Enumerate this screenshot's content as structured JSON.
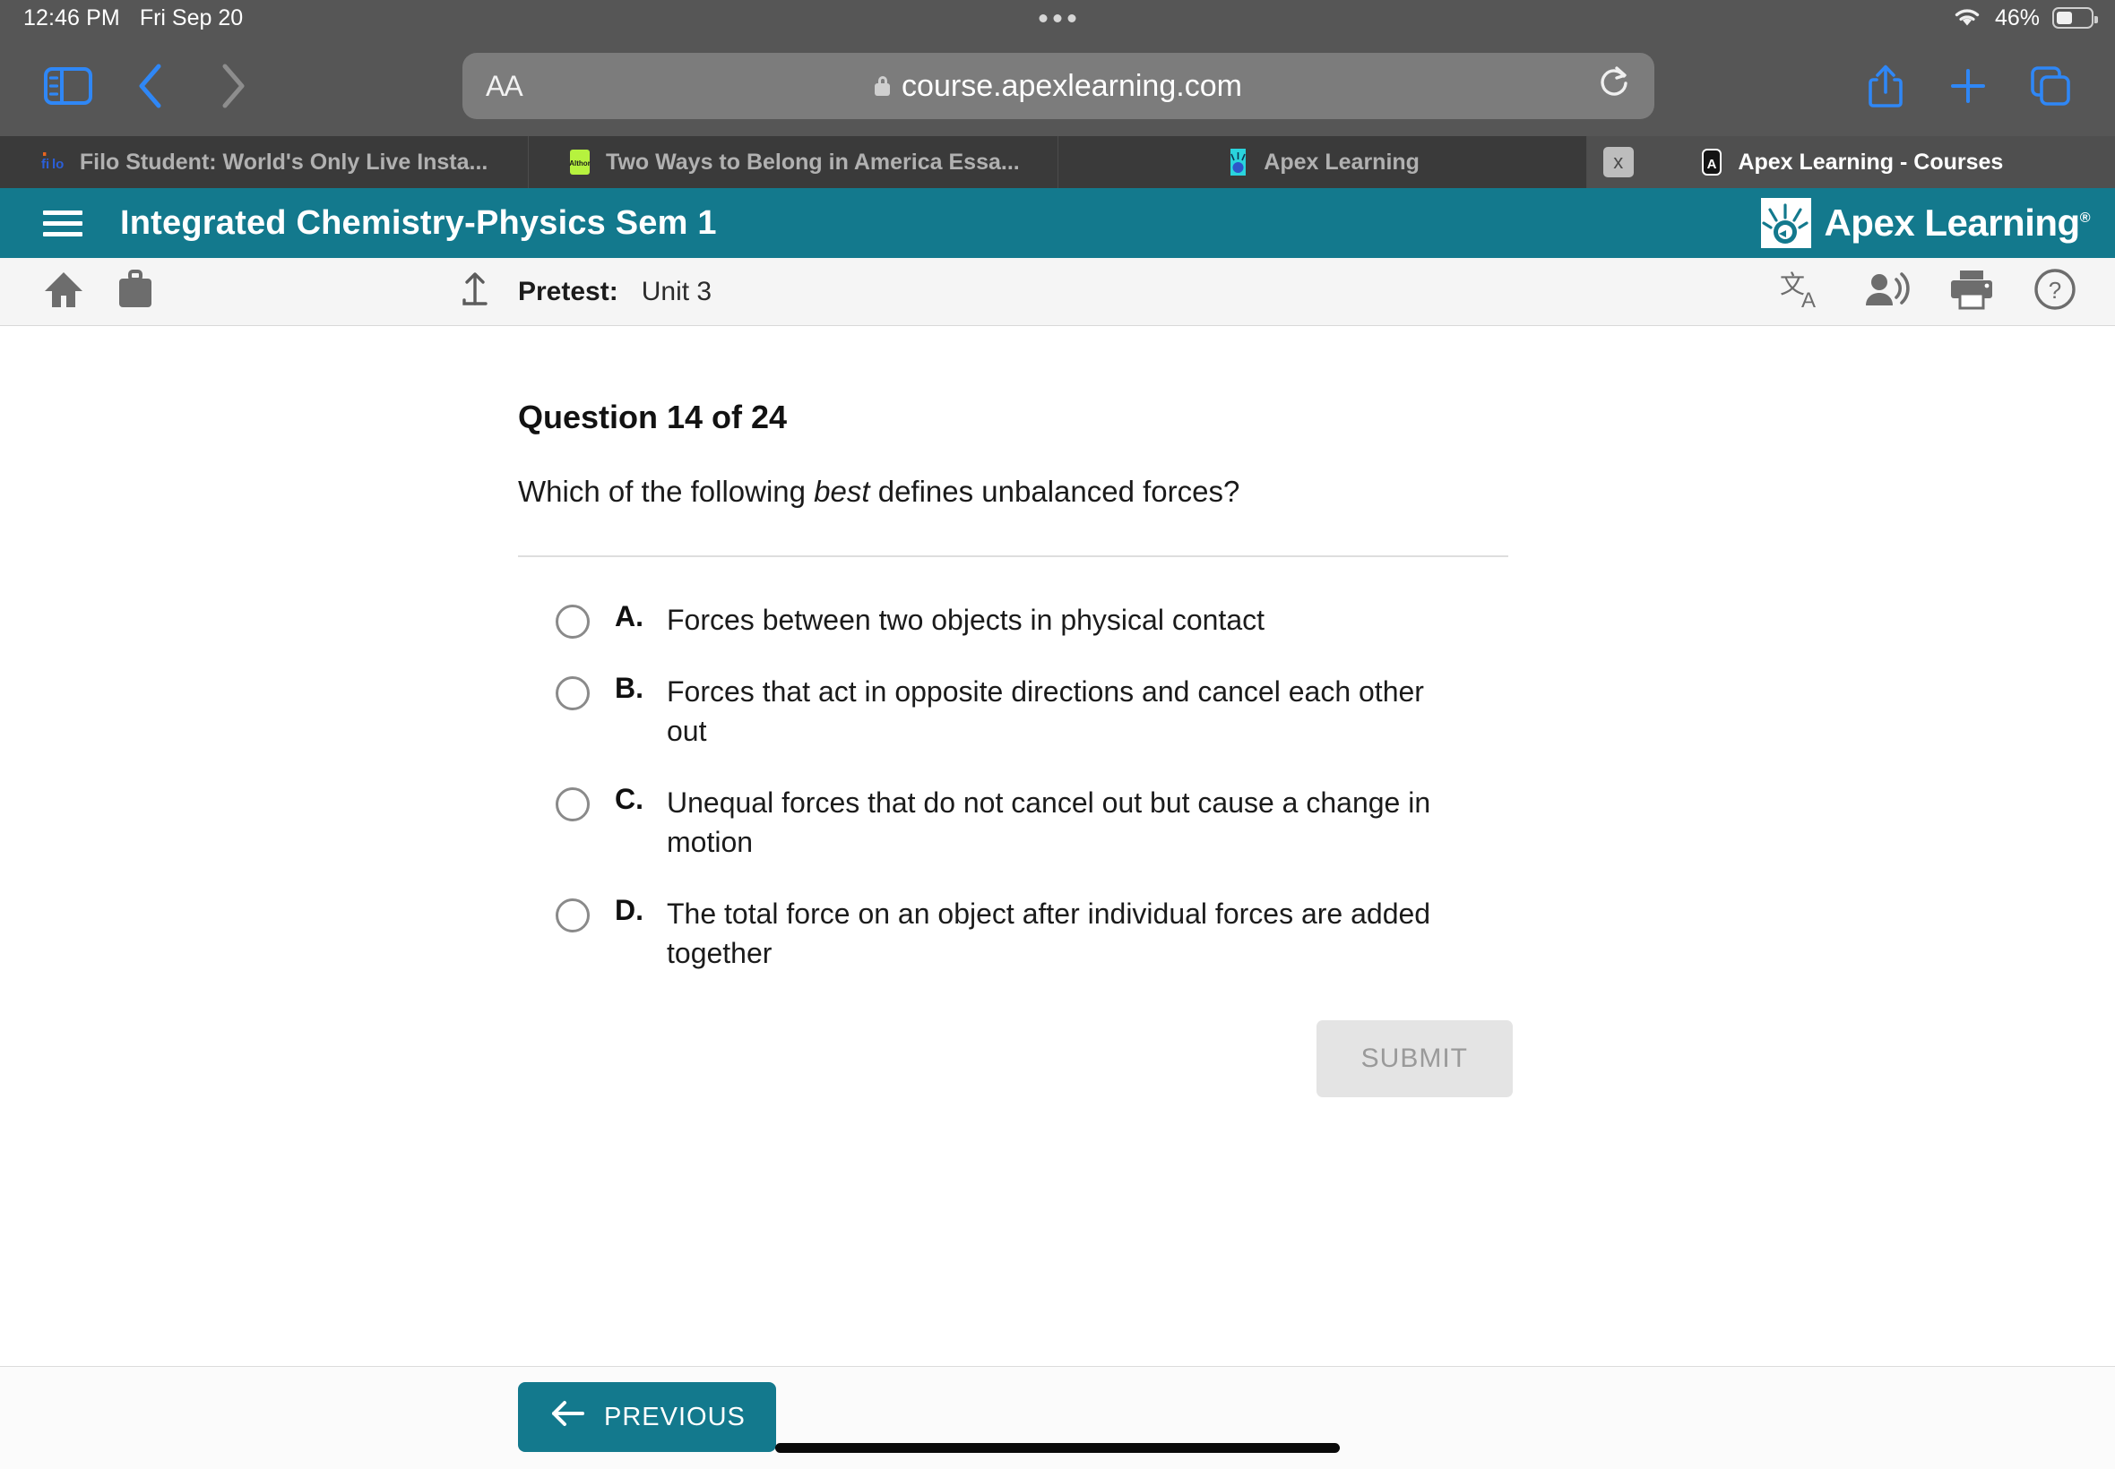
{
  "status_bar": {
    "time": "12:46 PM",
    "date": "Fri Sep 20",
    "battery_percent": "46%",
    "wifi_icon": "wifi-icon",
    "battery_icon": "battery-icon"
  },
  "browser": {
    "sidebar_icon": "sidebar-toggle-icon",
    "back_icon": "chevron-left-icon",
    "forward_icon": "chevron-right-icon",
    "text_size_label": "AA",
    "url": "course.apexlearning.com",
    "lock_icon": "lock-icon",
    "reload_icon": "reload-icon",
    "share_icon": "share-icon",
    "new_tab_icon": "plus-icon",
    "tabs_overview_icon": "tabs-overview-icon",
    "tabs": [
      {
        "label": "Filo Student: World's Only Live Insta...",
        "favicon": "filo-favicon",
        "active": false,
        "closable": false
      },
      {
        "label": "Two Ways to Belong in America Essa...",
        "favicon": "althor-favicon",
        "active": false,
        "closable": false
      },
      {
        "label": "Apex Learning",
        "favicon": "apex-favicon",
        "active": false,
        "closable": false
      },
      {
        "label": "Apex Learning - Courses",
        "favicon": "apex-a-favicon",
        "active": true,
        "closable": true,
        "close_label": "x"
      }
    ]
  },
  "course_header": {
    "menu_icon": "hamburger-menu-icon",
    "title": "Integrated Chemistry-Physics Sem 1",
    "brand_name": "Apex Learning",
    "brand_trademark": "®",
    "background_color": "#13798d"
  },
  "sub_toolbar": {
    "home_icon": "home-icon",
    "briefcase_icon": "briefcase-icon",
    "up_level_icon": "arrow-up-level-icon",
    "breadcrumb_label": "Pretest:",
    "breadcrumb_value": "Unit 3",
    "translate_icon": "translate-icon",
    "read-aloud_icon": "read-aloud-icon",
    "print_icon": "print-icon",
    "help_icon": "help-icon"
  },
  "question": {
    "number_label": "Question 14 of 24",
    "prompt_before": "Which of the following ",
    "prompt_emphasis": "best",
    "prompt_after": " defines unbalanced forces?",
    "choices": [
      {
        "letter": "A.",
        "text": "Forces between two objects in physical contact",
        "selected": false
      },
      {
        "letter": "B.",
        "text": "Forces that act in opposite directions and cancel each other out",
        "selected": false
      },
      {
        "letter": "C.",
        "text": "Unequal forces that do not cancel out but cause a change in motion",
        "selected": false
      },
      {
        "letter": "D.",
        "text": "The total force on an object after individual forces are added together",
        "selected": false
      }
    ],
    "submit_label": "SUBMIT",
    "submit_enabled": false
  },
  "footer": {
    "previous_label": "PREVIOUS",
    "previous_icon": "arrow-left-icon",
    "home_indicator": "home-indicator"
  }
}
